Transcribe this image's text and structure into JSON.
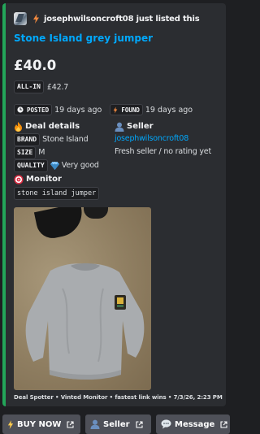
{
  "colors": {
    "accent_bar": "#23a559",
    "link": "#00a8fc",
    "embed_bg": "#2b2d31",
    "page_bg": "#1e1f22",
    "button_bg": "#4e5058"
  },
  "author": {
    "icon": "avatar-image",
    "bolt_icon": "lightning-icon",
    "text": "josephwilsoncroft08 just listed this"
  },
  "listing": {
    "title": "Stone Island grey jumper",
    "price": "£40.0",
    "all_in_label": "ALL-IN",
    "all_in_value": "£42.7"
  },
  "timestamps": {
    "posted_icon": "clock-icon",
    "posted_label": "POSTED",
    "posted_value": "19 days ago",
    "found_icon": "lightning-icon",
    "found_label": "FOUND",
    "found_value": "19 days ago"
  },
  "deal_details": {
    "icon": "fire-icon",
    "heading": "Deal details",
    "rows": [
      {
        "label": "BRAND",
        "value": "Stone Island"
      },
      {
        "label": "SIZE",
        "value": "M"
      },
      {
        "label": "QUALITY",
        "icon": "gem-icon",
        "value": "Very good"
      }
    ]
  },
  "seller": {
    "icon": "person-icon",
    "heading": "Seller",
    "name": "josephwilsoncroft08",
    "rating": "Fresh seller / no rating yet"
  },
  "monitor": {
    "icon": "target-icon",
    "heading": "Monitor",
    "query": "stone island jumper"
  },
  "footer": "Deal Spotter • Vinted Monitor • fastest link wins • 7/3/26, 2:23 PM",
  "buttons": [
    {
      "icon": "lightning-icon",
      "label": "BUY NOW"
    },
    {
      "icon": "person-icon",
      "label": "Seller"
    },
    {
      "icon": "speech-bubble-icon",
      "label": "Message"
    }
  ]
}
